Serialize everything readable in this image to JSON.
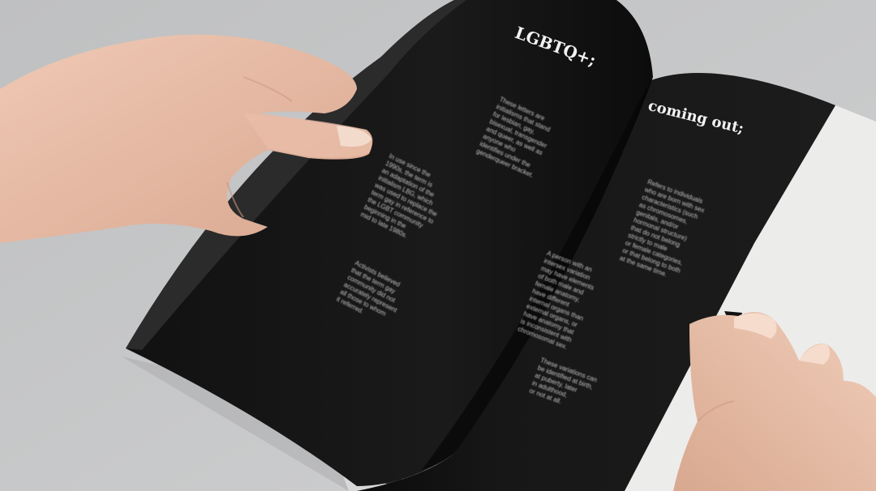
{
  "left_page": {
    "heading": "LGBTQ+;",
    "paragraph_1": "These letters are\ninitialisms that stand\nfor lesbian, gay,\nbisexual, transgender\nand queer, as well as\nanyone who\nidentifies under the\ngenderqueer bracket.",
    "paragraph_2": "In use since the\n1990s, the term is\nan adaptation of the\ninitialism LBG, which\nwas used to replace the\nterm gay in reference to\nthe LGBT community\nbeginning in the\nmid to late 1980s.",
    "paragraph_3": "Activists believed\nthat the term gay\ncommunity did not\naccurately represent\nall those to whom\nit referred."
  },
  "right_page": {
    "heading": "coming out;",
    "paragraph_1": "Refers to individuals\nwho are born with sex\ncharacteristics (such\nas chromosomes,\ngenitals, and/or\nhormonal structure)\nthat do not belong\nstrictly to male\nor female categories,\nor that belong to both\nat the same time.",
    "paragraph_2": "A person with an\nintersex variation\nmay have elements\nof both male and\nfemale anatomy,\nhave different\ninternal organs than\nexternal organs, or\nhave anatomy that\nis inconsistent with\nchromosomal sex.",
    "paragraph_3": "These variations can\nbe identified at birth,\nat puberty, later\nin adulthood,\nor not at all."
  },
  "colors": {
    "background": "#c9cacb",
    "page_black": "#151515",
    "white_page": "#ececeb",
    "text": "#e9e9e9",
    "skin": "#e3b9a3"
  }
}
